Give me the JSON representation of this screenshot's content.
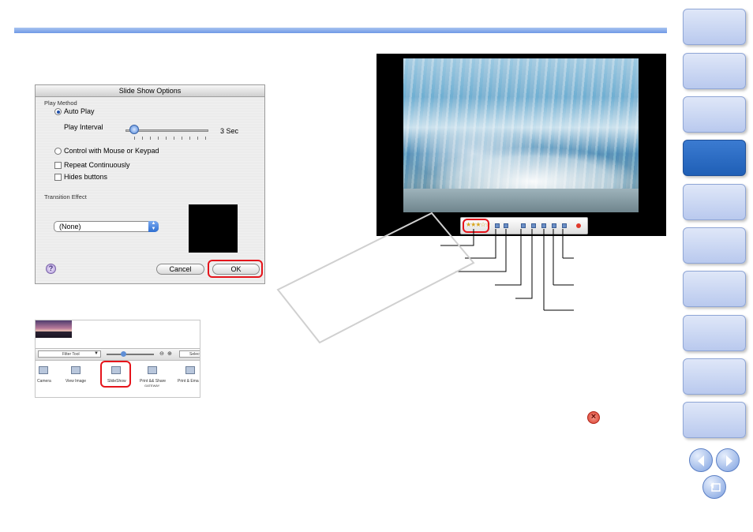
{
  "dialog": {
    "title": "Slide Show Options",
    "play_method": "Play Method",
    "auto_play": "Auto Play",
    "play_interval": "Play Interval",
    "interval_value": "3 Sec",
    "control_mouse": "Control with Mouse or Keypad",
    "repeat": "Repeat Continuously",
    "hides_buttons": "Hides buttons",
    "transition_effect": "Transition Effect",
    "transition_value": "(None)",
    "help": "?",
    "cancel": "Cancel",
    "ok": "OK"
  },
  "toolbar": {
    "filter_tool": "Filter Tool",
    "select": "Select",
    "camera": "Camera",
    "view_image": "View Image",
    "slideshow": "SlideShow",
    "print_share": "Print && Share",
    "gateway": "GATEWAY",
    "print_email": "Print & Ema"
  },
  "colors": {
    "accent_blue": "#6f99e6",
    "active_tab": "#2a6cc4",
    "highlight_red": "#e5141b"
  },
  "side_nav": {
    "tab_count": 10,
    "active_index": 3
  }
}
